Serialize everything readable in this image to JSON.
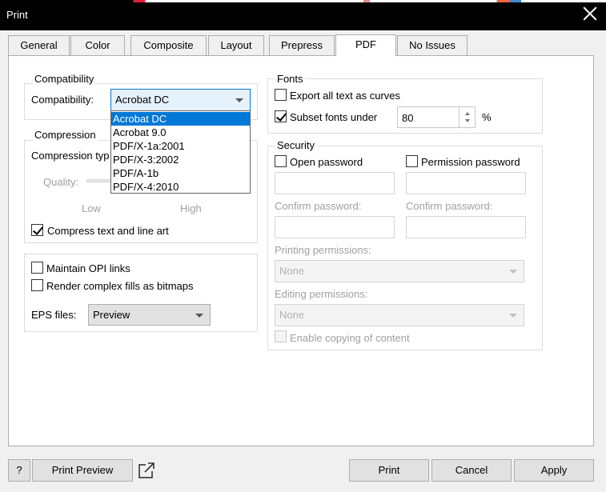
{
  "window": {
    "title": "Print"
  },
  "tabs": [
    "General",
    "Color",
    "Composite",
    "Layout",
    "Prepress",
    "PDF",
    "No Issues"
  ],
  "active_tab": "PDF",
  "compatibility": {
    "group_label": "Compatibility",
    "label": "Compatibility:",
    "value": "Acrobat DC",
    "options": [
      "Acrobat DC",
      "Acrobat 9.0",
      "PDF/X-1a:2001",
      "PDF/X-3:2002",
      "PDF/A-1b",
      "PDF/X-4:2010"
    ]
  },
  "compression": {
    "group_label": "Compression",
    "type_label": "Compression typ",
    "quality_label": "Quality:",
    "low_label": "Low",
    "high_label": "High",
    "compress_text_label": "Compress text and line art",
    "compress_text_checked": true
  },
  "misc": {
    "maintain_opi_label": "Maintain OPI links",
    "render_complex_label": "Render complex fills as bitmaps",
    "eps_label": "EPS files:",
    "eps_value": "Preview"
  },
  "fonts": {
    "group_label": "Fonts",
    "export_curves_label": "Export all text as curves",
    "subset_label": "Subset fonts under",
    "subset_checked": true,
    "subset_value": "80",
    "percent_label": "%"
  },
  "security": {
    "group_label": "Security",
    "open_password_label": "Open password",
    "permission_password_label": "Permission password",
    "confirm_password_label": "Confirm password:",
    "confirm_password_label_2": "Confirm password:",
    "printing_permissions_label": "Printing permissions:",
    "printing_permissions_value": "None",
    "editing_permissions_label": "Editing permissions:",
    "editing_permissions_value": "None",
    "enable_copying_label": "Enable copying of content"
  },
  "footer": {
    "help_label": "?",
    "print_preview_label": "Print Preview",
    "print_label": "Print",
    "cancel_label": "Cancel",
    "apply_label": "Apply"
  }
}
